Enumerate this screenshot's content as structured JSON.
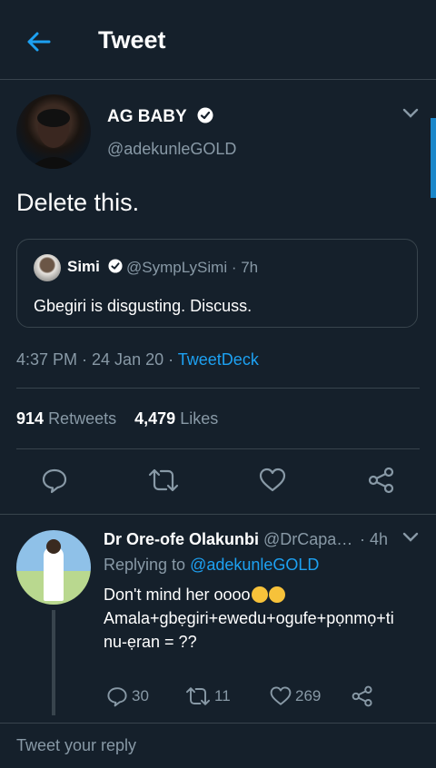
{
  "header": {
    "title": "Tweet"
  },
  "tweet": {
    "author_name": "AG BABY",
    "author_handle": "@adekunleGOLD",
    "text": "Delete this.",
    "quoted": {
      "name": "Simi",
      "handle_time": "@SympLySimi · 7h",
      "text": "Gbegiri is disgusting. Discuss."
    },
    "time_date": "4:37 PM · 24 Jan 20 · ",
    "source": "TweetDeck",
    "retweets_count": "914",
    "retweets_label": "Retweets",
    "likes_count": "4,479",
    "likes_label": "Likes"
  },
  "reply": {
    "name": "Dr Ore-ofe Olakunbi",
    "handle": "@DrCapa…",
    "time": "· 4h",
    "replying_prefix": "Replying to ",
    "replying_to": "@adekunleGOLD",
    "line1": "Don't mind her oooo",
    "line2": "Amala+gbẹgiri+ewedu+ogufe+pọnmọ+ti",
    "line3": "nu-ẹran = ??",
    "reply_count": "30",
    "retweet_count": "11",
    "like_count": "269"
  },
  "composer": {
    "placeholder": "Tweet your reply"
  },
  "colors": {
    "background": "#15202b",
    "accent": "#1da1f2",
    "muted": "#8899a6",
    "border": "#38444d"
  }
}
